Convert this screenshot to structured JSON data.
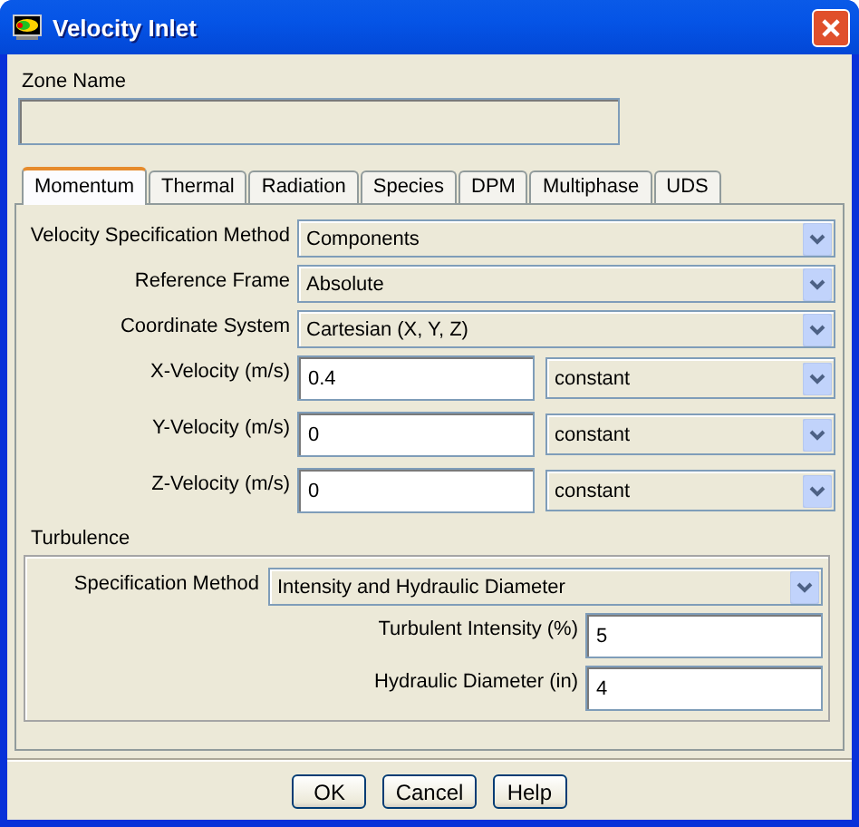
{
  "window": {
    "title": "Velocity Inlet"
  },
  "zone_name": {
    "label": "Zone Name",
    "disabled": true
  },
  "tabs": [
    {
      "label": "Momentum",
      "selected": true
    },
    {
      "label": "Thermal",
      "selected": false
    },
    {
      "label": "Radiation",
      "selected": false
    },
    {
      "label": "Species",
      "selected": false
    },
    {
      "label": "DPM",
      "selected": false
    },
    {
      "label": "Multiphase",
      "selected": false
    },
    {
      "label": "UDS",
      "selected": false
    }
  ],
  "momentum": [
    {
      "kind": "dropdown",
      "label": "Velocity Specification Method",
      "value": "Components"
    },
    {
      "kind": "dropdown",
      "label": "Reference Frame",
      "value": "Absolute"
    },
    {
      "kind": "dropdown",
      "label": "Coordinate System",
      "value": "Cartesian (X, Y, Z)"
    },
    {
      "kind": "number",
      "label": "X-Velocity (m/s)",
      "value": "0.4",
      "profile": "constant"
    },
    {
      "kind": "number",
      "label": "Y-Velocity (m/s)",
      "value": "0",
      "profile": "constant"
    },
    {
      "kind": "number",
      "label": "Z-Velocity (m/s)",
      "value": "0",
      "profile": "constant"
    }
  ],
  "turbulence": {
    "title": "Turbulence",
    "fields": [
      {
        "kind": "dropdown",
        "label": "Specification Method",
        "value": "Intensity and Hydraulic Diameter"
      },
      {
        "kind": "number",
        "label": "Turbulent Intensity (%)",
        "value": "5"
      },
      {
        "kind": "number",
        "label": "Hydraulic Diameter (in)",
        "value": "4"
      }
    ]
  },
  "buttons": [
    "OK",
    "Cancel",
    "Help"
  ]
}
